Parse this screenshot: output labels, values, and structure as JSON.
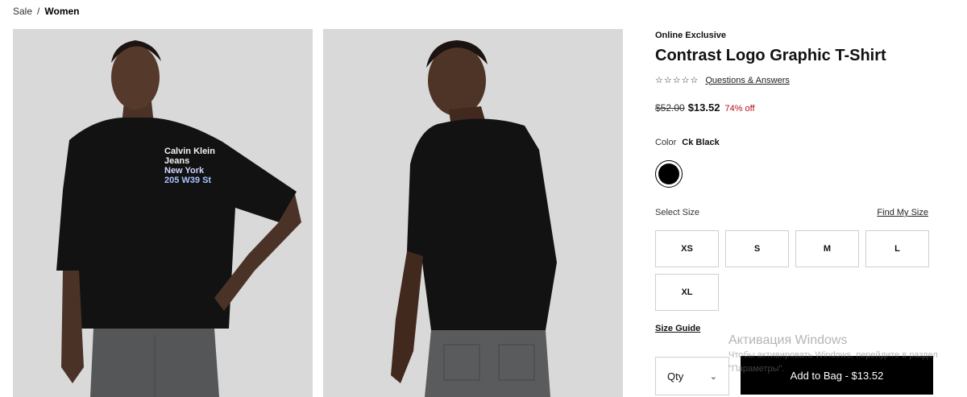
{
  "breadcrumb": {
    "items": [
      "Sale",
      "Women"
    ],
    "separator": "/"
  },
  "product": {
    "badge": "Online Exclusive",
    "title": "Contrast Logo Graphic T-Shirt",
    "rating_stars": "☆☆☆☆☆",
    "qa_link": "Questions & Answers",
    "price_original": "$52.00",
    "price_sale": "$13.52",
    "discount": "74% off",
    "color_label": "Color",
    "color_value": "Ck Black",
    "swatch_color": "#000000",
    "size_label": "Select Size",
    "find_size": "Find My Size",
    "sizes": [
      "XS",
      "S",
      "M",
      "L",
      "XL"
    ],
    "size_guide": "Size Guide",
    "qty_label": "Qty",
    "add_to_bag": "Add to Bag - $13.52"
  },
  "gallery": {
    "image_1_alt": "Model front view",
    "image_2_alt": "Model back view",
    "print_lines": [
      "Calvin Klein",
      "Jeans",
      "New York",
      "205 W39 St"
    ]
  },
  "watermark": {
    "title": "Активация Windows",
    "line1": "Чтобы активировать Windows, перейдите в раздел",
    "line2": "\"Параметры\"."
  },
  "colors": {
    "discount": "#b3101b",
    "button_bg": "#000000",
    "photo_bg": "#d9d9d9"
  }
}
